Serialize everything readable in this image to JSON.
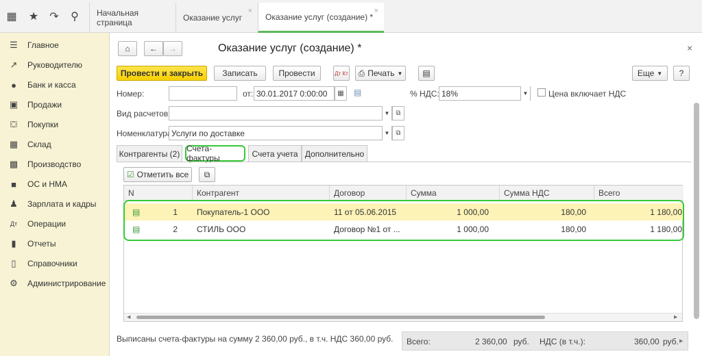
{
  "topbar": {
    "icons": [
      "apps-grid-icon",
      "star-icon",
      "history-icon",
      "search-icon"
    ],
    "tabs": [
      {
        "label": "Начальная страница"
      },
      {
        "label": "Оказание услуг"
      },
      {
        "label": "Оказание услуг (создание) *"
      }
    ]
  },
  "sidebar": {
    "items": [
      {
        "label": "Главное",
        "icon": "menu-icon"
      },
      {
        "label": "Руководителю",
        "icon": "trend-icon"
      },
      {
        "label": "Банк и касса",
        "icon": "bank-icon"
      },
      {
        "label": "Продажи",
        "icon": "bag-icon"
      },
      {
        "label": "Покупки",
        "icon": "cart-icon"
      },
      {
        "label": "Склад",
        "icon": "warehouse-icon"
      },
      {
        "label": "Производство",
        "icon": "factory-icon"
      },
      {
        "label": "ОС и НМА",
        "icon": "truck-icon"
      },
      {
        "label": "Зарплата и кадры",
        "icon": "person-icon"
      },
      {
        "label": "Операции",
        "icon": "dt-kt-icon"
      },
      {
        "label": "Отчеты",
        "icon": "chart-icon"
      },
      {
        "label": "Справочники",
        "icon": "book-icon"
      },
      {
        "label": "Администрирование",
        "icon": "gear-icon"
      }
    ]
  },
  "form": {
    "title": "Оказание услуг (создание) *",
    "close": "×",
    "toolbar": {
      "post_close": "Провести и закрыть",
      "save": "Записать",
      "post": "Провести",
      "print": "Печать",
      "more": "Еще",
      "help": "?",
      "dtkt": "Дт Кт"
    },
    "fields": {
      "number_label": "Номер:",
      "number_value": "",
      "date_label": "от:",
      "date_value": "30.01.2017  0:00:00",
      "vat_label": "% НДС:",
      "vat_value": "18%",
      "price_incl_vat": "Цена включает НДС",
      "settlement_label": "Вид расчетов:",
      "settlement_value": "",
      "nomenclature_label": "Номенклатура:",
      "nomenclature_value": "Услуги по доставке"
    },
    "tabs": [
      {
        "label": "Контрагенты (2)"
      },
      {
        "label": "Счета-фактуры"
      },
      {
        "label": "Счета учета"
      },
      {
        "label": "Дополнительно"
      }
    ],
    "mark_all": "Отметить все",
    "table": {
      "headers": [
        "N",
        "Контрагент",
        "Договор",
        "Сумма",
        "Сумма НДС",
        "Всего"
      ],
      "rows": [
        {
          "n": "1",
          "counterparty": "Покупатель-1 ООО",
          "contract": "11 от 05.06.2015",
          "sum": "1 000,00",
          "vat": "180,00",
          "total": "1 180,00"
        },
        {
          "n": "2",
          "counterparty": "СТИЛЬ ООО",
          "contract": "Договор №1 от ...",
          "sum": "1 000,00",
          "vat": "180,00",
          "total": "1 180,00"
        }
      ]
    },
    "footer": {
      "summary": "Выписаны счета-фактуры на сумму 2 360,00 руб., в т.ч. НДС 360,00 руб.",
      "total_label": "Всего:",
      "total_value": "2 360,00",
      "total_cur": "руб.",
      "vat_label": "НДС (в т.ч.):",
      "vat_value": "360,00",
      "vat_cur": "руб."
    }
  },
  "colors": {
    "accent": "#37c937",
    "primary_button": "#f6d100",
    "sidebar_bg": "#f7f3d4"
  }
}
